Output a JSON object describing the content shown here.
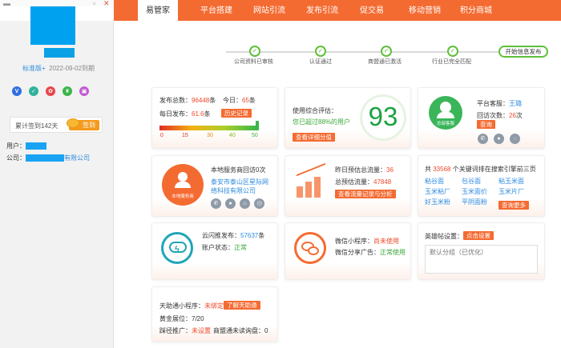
{
  "sidebar": {
    "version_link": "标准版+",
    "expiry": "2022-09-02到期",
    "checkin_text": "累计签到142天",
    "checkin_button": "签到",
    "user_label": "用户：",
    "company_label": "公司：",
    "company_suffix": "有限公司",
    "icons": [
      {
        "name": "v-badge",
        "glyph": "V",
        "color": "#2f6fe0"
      },
      {
        "name": "shield-icon",
        "glyph": "✓",
        "color": "#2fb39a"
      },
      {
        "name": "ribbon-icon",
        "glyph": "✿",
        "color": "#e8464b"
      },
      {
        "name": "yen-icon",
        "glyph": "¥",
        "color": "#3ab54a"
      },
      {
        "name": "image-icon",
        "glyph": "▣",
        "color": "#c05ccf"
      }
    ]
  },
  "nav": {
    "items": [
      "易管家",
      "平台搭建",
      "网站引流",
      "发布引流",
      "促交易",
      "移动营销",
      "积分商城"
    ],
    "active": 0,
    "accent": "#f46b32"
  },
  "progress": {
    "steps": [
      "公司资料已审核",
      "认证通过",
      "商盟通已激活",
      "行业已完全匹配"
    ],
    "button": "开始信息发布"
  },
  "card_publish": {
    "total_label": "发布总数：",
    "total_value": "96448",
    "total_unit": "条",
    "today_label": "今日：",
    "today_value": "65",
    "today_unit": "条",
    "daily_label": "每日发布：",
    "daily_value": "61.6",
    "daily_unit": "条",
    "history_button": "历史记录",
    "scale": [
      "0",
      "15",
      "30",
      "40",
      "50"
    ],
    "gauge_value": 50
  },
  "card_score": {
    "title": "使用综合评估：",
    "exceed": "您已超过88%的用户",
    "score": "93",
    "details_button": "查看详细分值"
  },
  "card_service": {
    "platform_label": "平台客服：",
    "platform_name": "王璐",
    "visits_label": "回访次数：",
    "visits_value": "26",
    "visits_unit": "次",
    "visit_button": "查询",
    "avatar_caption": "总部客服"
  },
  "card_local": {
    "title": "本地服务商回访0次",
    "company": "泰安市泰山区星际网络科技有限公司",
    "icon_caption": "本地服务商"
  },
  "card_flow": {
    "yesterday_label": "昨日预估总流量：",
    "yesterday_value": "36",
    "total_label": "总预估流量：",
    "total_value": "47848",
    "button": "查看流量记录与分析"
  },
  "card_keywords": {
    "prefix": "共",
    "count": "33568",
    "suffix": "个关键词排在搜索引擎前三页",
    "keywords": [
      "粘谷面",
      "包谷面",
      "粘玉米面",
      "玉米粘厂",
      "玉米面价",
      "玉米片厂",
      "好玉米粉",
      "平阴面粉"
    ],
    "more_button": "查询更多"
  },
  "card_cloud": {
    "published_label": "云闪推发布：",
    "published_value": "57637",
    "published_unit": "条",
    "status_label": "账户状态：",
    "status_value": "正常"
  },
  "card_wechat": {
    "miniapp_label": "微信小程序：",
    "miniapp_value": "尚未使用",
    "ad_label": "微信分享广告：",
    "ad_value": "正常使用"
  },
  "card_yingbao": {
    "label": "英雄帖设置：",
    "button": "点击设置",
    "placeholder": "默认分组（已优化）"
  },
  "card_tianzhu": {
    "miniapp_label": "天助通小程序：",
    "miniapp_value": "未绑定",
    "learn_button": "了解天助通",
    "gold_label": "黄金展位：",
    "gold_value": "7/20",
    "promote_label": "踩径推广：",
    "promote_value": "未设置",
    "shangmeng_label": "商盟通未读询盘：",
    "shangmeng_value": "0"
  }
}
